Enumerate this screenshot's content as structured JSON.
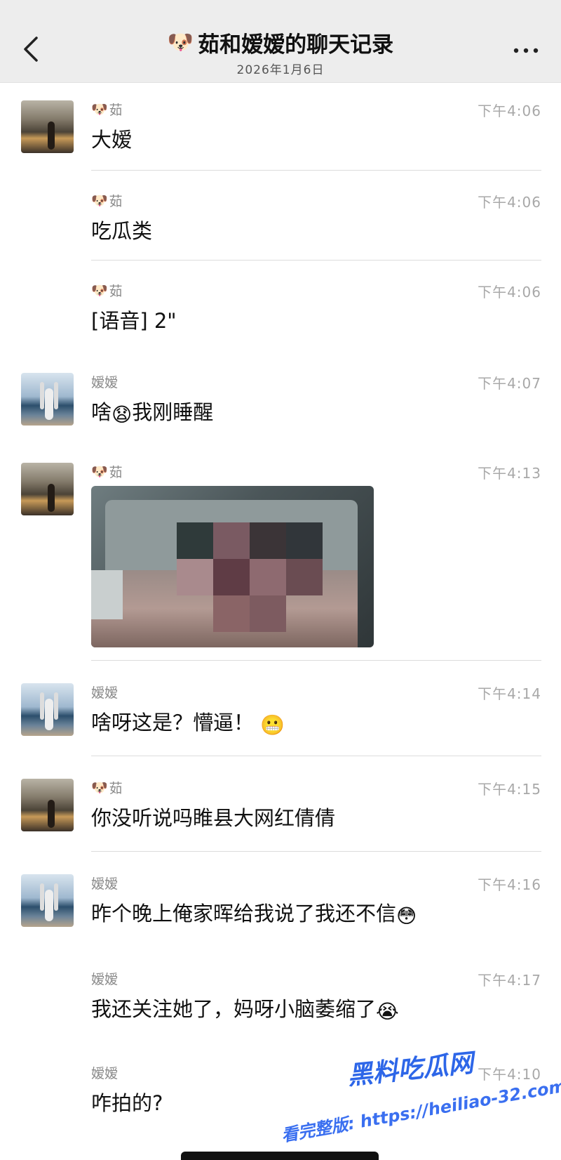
{
  "header": {
    "title": "茹和嫒嫒的聊天记录",
    "subtitle": "2026年1月6日",
    "title_icon": "dog-face-icon"
  },
  "messages": [
    {
      "sender": "茹",
      "sender_icon": "dog-face-icon",
      "time": "下午4:06",
      "text": "大嫒"
    },
    {
      "sender": "茹",
      "sender_icon": "dog-face-icon",
      "time": "下午4:06",
      "text": "吃瓜类"
    },
    {
      "sender": "茹",
      "sender_icon": "dog-face-icon",
      "time": "下午4:06",
      "text": "[语音] 2\""
    },
    {
      "sender": "嫒嫒",
      "time": "下午4:07",
      "text_before": "啥",
      "emoji_icon": "frowning-face-icon",
      "emoji": "😧",
      "text_after": "我刚睡醒"
    },
    {
      "sender": "茹",
      "sender_icon": "dog-face-icon",
      "time": "下午4:13",
      "attachment": "photo"
    },
    {
      "sender": "嫒嫒",
      "time": "下午4:14",
      "text": "啥呀这是？懵逼！",
      "emoji_icon": "grin-face-icon",
      "emoji": "😬"
    },
    {
      "sender": "茹",
      "sender_icon": "dog-face-icon",
      "time": "下午4:15",
      "text": "你没听说吗睢县大网红倩倩"
    },
    {
      "sender": "嫒嫒",
      "time": "下午4:16",
      "text": "昨个晚上俺家晖给我说了我还不信",
      "emoji_icon": "flushed-face-icon",
      "emoji": "😳"
    },
    {
      "sender": "嫒嫒",
      "time": "下午4:17",
      "text": "我还关注她了，妈呀小脑萎缩了",
      "emoji_icon": "crying-face-icon",
      "emoji": "😭"
    },
    {
      "sender": "嫒嫒",
      "time": "下午4:10",
      "text": "咋拍的?"
    }
  ],
  "watermark": {
    "brand": "黑料吃瓜网",
    "link": "看完整版: https://heiliao-32.com"
  },
  "colors": {
    "header_bg": "#ededed",
    "time_text": "#a8a8a8",
    "sender_text": "#8a8a8a",
    "watermark": "#2d66e8"
  }
}
